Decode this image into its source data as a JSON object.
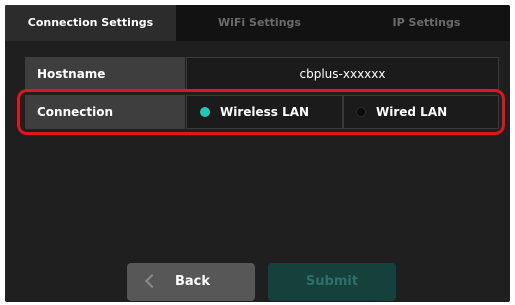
{
  "tabs": [
    {
      "label": "Connection Settings",
      "active": true
    },
    {
      "label": "WiFi Settings",
      "active": false
    },
    {
      "label": "IP Settings",
      "active": false
    }
  ],
  "hostname": {
    "label": "Hostname",
    "value": "cbplus-xxxxxx"
  },
  "connection": {
    "label": "Connection",
    "options": [
      {
        "label": "Wireless LAN",
        "selected": true
      },
      {
        "label": "Wired LAN",
        "selected": false
      }
    ]
  },
  "buttons": {
    "back_label": "Back",
    "submit_label": "Submit"
  },
  "colors": {
    "accent": "#25c7b4",
    "highlight": "#e0161b",
    "background": "#1f1f1f"
  }
}
